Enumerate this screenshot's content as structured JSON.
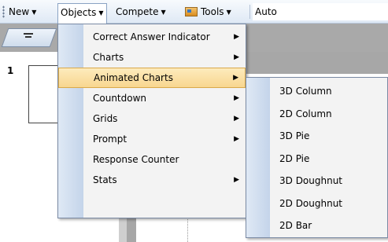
{
  "toolbar": {
    "new_label": "New",
    "objects_label": "Objects",
    "compete_label": "Compete",
    "tools_label": "Tools",
    "auto_value": "Auto"
  },
  "slide": {
    "number": "1"
  },
  "objects_menu": {
    "items": [
      {
        "label": "Correct Answer Indicator",
        "submenu": true
      },
      {
        "label": "Charts",
        "submenu": true
      },
      {
        "label": "Animated Charts",
        "submenu": true,
        "highlighted": true
      },
      {
        "label": "Countdown",
        "submenu": true
      },
      {
        "label": "Grids",
        "submenu": true
      },
      {
        "label": "Prompt",
        "submenu": true
      },
      {
        "label": "Response Counter",
        "submenu": false
      },
      {
        "label": "Stats",
        "submenu": true
      }
    ]
  },
  "animated_charts_menu": {
    "items": [
      {
        "label": "3D Column"
      },
      {
        "label": "2D Column"
      },
      {
        "label": "3D Pie"
      },
      {
        "label": "2D Pie"
      },
      {
        "label": "3D Doughnut"
      },
      {
        "label": "2D Doughnut"
      },
      {
        "label": "2D Bar"
      }
    ]
  },
  "icons": {
    "submenu_arrow": "triangle-right-icon",
    "dropdown_caret": "chevron-down-icon",
    "tools": "tools-icon",
    "tab": "list-icon"
  },
  "colors": {
    "highlight": "#f8d68f",
    "menu_background": "#f3f3f3",
    "toolbar": "#dfe9f5"
  }
}
